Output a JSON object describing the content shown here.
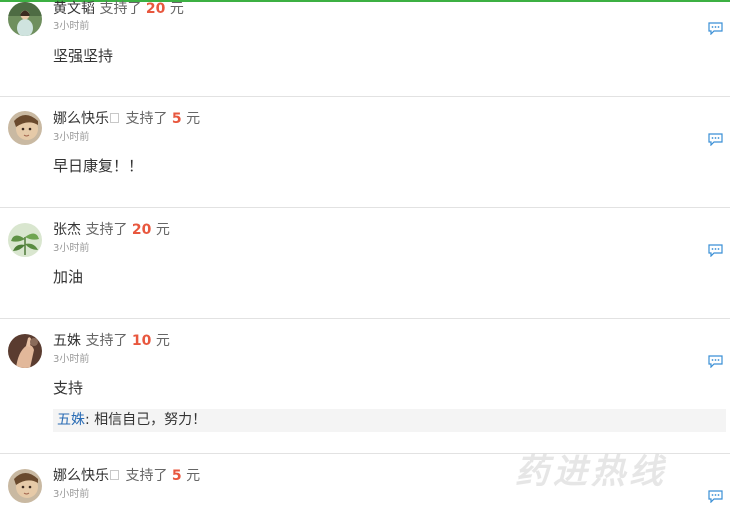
{
  "comments": [
    {
      "name": "黄文韬",
      "verb": "支持了",
      "amount": "20",
      "unit": "元",
      "time": "3小时前",
      "message": "坚强坚持",
      "avatar": "avatar-girl-outdoor",
      "has_square": false,
      "reply": null
    },
    {
      "name": "娜么快乐",
      "verb": "支持了",
      "amount": "5",
      "unit": "元",
      "time": "3小时前",
      "message": "早日康复！！",
      "avatar": "avatar-face",
      "has_square": true,
      "reply": null
    },
    {
      "name": "张杰",
      "verb": "支持了",
      "amount": "20",
      "unit": "元",
      "time": "3小时前",
      "message": "加油",
      "avatar": "avatar-plant",
      "has_square": false,
      "reply": null
    },
    {
      "name": "五姝",
      "verb": "支持了",
      "amount": "10",
      "unit": "元",
      "time": "3小时前",
      "message": "支持",
      "avatar": "avatar-hand",
      "has_square": false,
      "reply": {
        "name": "五姝",
        "text": "相信自己，努力！"
      }
    },
    {
      "name": "娜么快乐",
      "verb": "支持了",
      "amount": "5",
      "unit": "元",
      "time": "3小时前",
      "message": "",
      "avatar": "avatar-face",
      "has_square": true,
      "reply": null
    }
  ],
  "icons": {
    "reply": "comment-bubble-icon"
  },
  "colors": {
    "top_bar": "#3cb043",
    "amount": "#e8573e",
    "reply_name": "#2b6db5",
    "icon": "#3a8fd6"
  },
  "watermark": "药进热线"
}
